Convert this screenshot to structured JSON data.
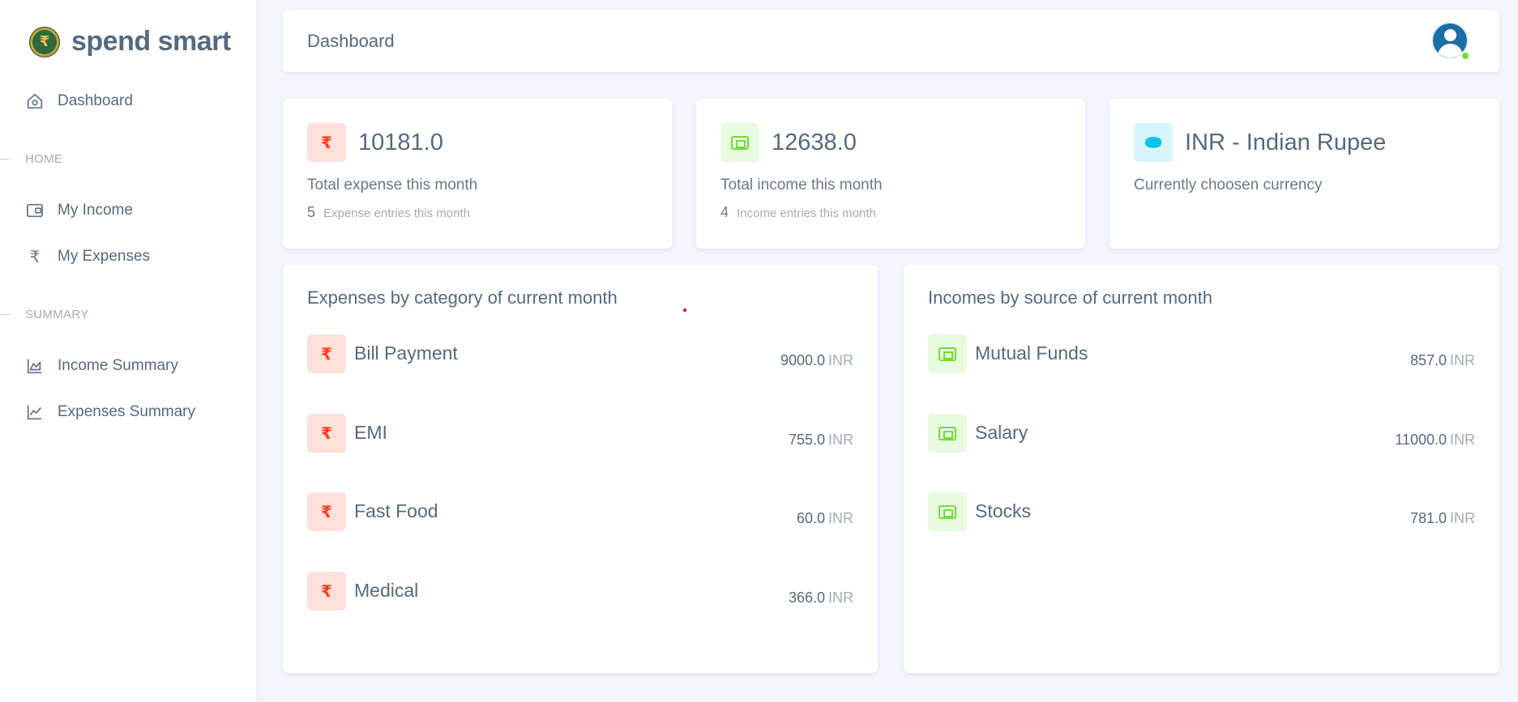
{
  "app": {
    "brand_name": "spend smart",
    "logo_symbol": "₹",
    "brand_color": "#566a7f"
  },
  "sidebar": {
    "dashboard_label": "Dashboard",
    "home_header": "HOME",
    "my_income_label": "My Income",
    "my_expenses_label": "My Expenses",
    "summary_header": "SUMMARY",
    "income_summary_label": "Income Summary",
    "expenses_summary_label": "Expenses Summary"
  },
  "header": {
    "title": "Dashboard"
  },
  "stats": {
    "expense": {
      "value": "10181.0",
      "label": "Total expense this month",
      "count": "5",
      "count_label": "Expense entries this month",
      "icon": "₹"
    },
    "income": {
      "value": "12638.0",
      "label": "Total income this month",
      "count": "4",
      "count_label": "Income entries this month"
    },
    "currency": {
      "value": "INR - Indian Rupee",
      "label": "Currently choosen currency"
    }
  },
  "expenses_by_category": {
    "title": "Expenses by category of current month",
    "currency": "INR",
    "icon": "₹",
    "items": [
      {
        "name": "Bill Payment",
        "amount": "9000.0"
      },
      {
        "name": "EMI",
        "amount": "755.0"
      },
      {
        "name": "Fast Food",
        "amount": "60.0"
      },
      {
        "name": "Medical",
        "amount": "366.0"
      }
    ]
  },
  "incomes_by_source": {
    "title": "Incomes by source of current month",
    "currency": "INR",
    "items": [
      {
        "name": "Mutual Funds",
        "amount": "857.0"
      },
      {
        "name": "Salary",
        "amount": "11000.0"
      },
      {
        "name": "Stocks",
        "amount": "781.0"
      }
    ]
  },
  "colors": {
    "expense_accent": "#ff3e1d",
    "income_accent": "#71dd37",
    "currency_accent": "#03c3ec",
    "background": "#f4f5fa"
  }
}
